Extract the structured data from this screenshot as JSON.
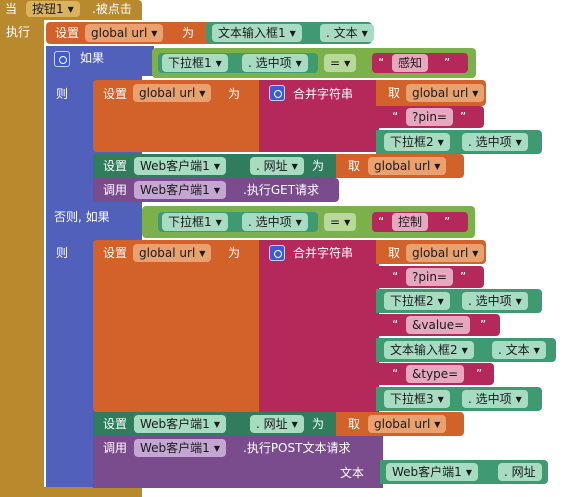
{
  "event": {
    "when": "当",
    "component": "按钮1",
    "event_name": ".被点击",
    "do": "执行"
  },
  "set1": {
    "set": "设置",
    "var": "global url",
    "to": "为",
    "component": "文本输入框1",
    "prop": ". 文本"
  },
  "if1": {
    "if": "如果",
    "dropdown": "下拉框1",
    "prop": ". 选中项",
    "op": "=",
    "str": "感知"
  },
  "then": "则",
  "set2": {
    "set": "设置",
    "var": "global url",
    "to": "为",
    "join": "合并字符串",
    "get": "取",
    "get_var": "global url",
    "str": "?pin=",
    "dropdown": "下拉框2",
    "prop": ". 选中项"
  },
  "set3": {
    "set": "设置",
    "component": "Web客户端1",
    "prop": ". 网址",
    "to": "为",
    "get": "取",
    "get_var": "global url"
  },
  "call1": {
    "call": "调用",
    "component": "Web客户端1",
    "method": ".执行GET请求"
  },
  "elseif": {
    "label": "否则, 如果",
    "dropdown": "下拉框1",
    "prop": ". 选中项",
    "op": "=",
    "str": "控制"
  },
  "then2": "则",
  "set4": {
    "set": "设置",
    "var": "global url",
    "to": "为",
    "join": "合并字符串",
    "get": "取",
    "get_var": "global url",
    "str1": "?pin=",
    "dd2": "下拉框2",
    "prop2": ". 选中项",
    "str2": "&value=",
    "text2": "文本输入框2",
    "text_prop": ". 文本",
    "str3": "&type=",
    "dd3": "下拉框3",
    "prop3": ". 选中项"
  },
  "set5": {
    "set": "设置",
    "component": "Web客户端1",
    "prop": ". 网址",
    "to": "为",
    "get": "取",
    "get_var": "global url"
  },
  "call2": {
    "call": "调用",
    "component": "Web客户端1",
    "method": ".执行POST文本请求",
    "arg": "文本",
    "arg_comp": "Web客户端1",
    "arg_prop": ". 网址"
  },
  "quote_l": "“",
  "quote_r": "”",
  "colors": {
    "event": "#b9892e",
    "procedure": "#d2612a",
    "component_set": "#2f7d5c",
    "component_get": "#3f9a72",
    "logic": "#7bb04b",
    "text": "#b4285a",
    "call": "#7a4c8e"
  }
}
